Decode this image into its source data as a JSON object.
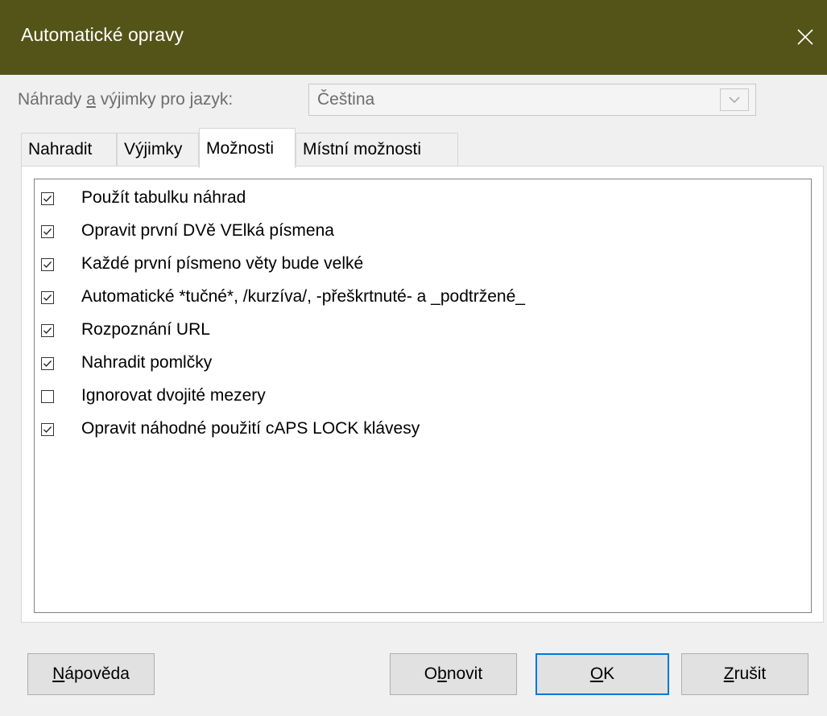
{
  "window": {
    "title": "Automatické opravy"
  },
  "language": {
    "label_prefix": "Náhrady ",
    "label_accel": "a",
    "label_suffix": " výjimky pro jazyk:",
    "selected": "Čeština"
  },
  "tabs": [
    {
      "label": "Nahradit",
      "active": false
    },
    {
      "label": "Výjimky",
      "active": false
    },
    {
      "label": "Možnosti",
      "active": true
    },
    {
      "label": "Místní možnosti",
      "active": false
    }
  ],
  "options": [
    {
      "label": "Použít tabulku náhrad",
      "checked": true
    },
    {
      "label": "Opravit první DVě VElká písmena",
      "checked": true
    },
    {
      "label": "Každé první písmeno věty bude velké",
      "checked": true
    },
    {
      "label": "Automatické *tučné*, /kurzíva/, -přeškrtnuté- a _podtržené_",
      "checked": true
    },
    {
      "label": "Rozpoznání URL",
      "checked": true
    },
    {
      "label": "Nahradit pomlčky",
      "checked": true
    },
    {
      "label": "Ignorovat dvojité mezery",
      "checked": false
    },
    {
      "label": "Opravit náhodné použití cAPS LOCK klávesy",
      "checked": true
    }
  ],
  "buttons": {
    "help": {
      "accel": "N",
      "rest": "ápověda"
    },
    "reset": {
      "pre": "O",
      "accel": "b",
      "rest": "novit"
    },
    "ok": {
      "accel": "O",
      "rest": "K"
    },
    "cancel": {
      "accel": "Z",
      "rest": "rušit"
    }
  },
  "colors": {
    "titlebar": "#545418",
    "accent": "#0078d7"
  }
}
